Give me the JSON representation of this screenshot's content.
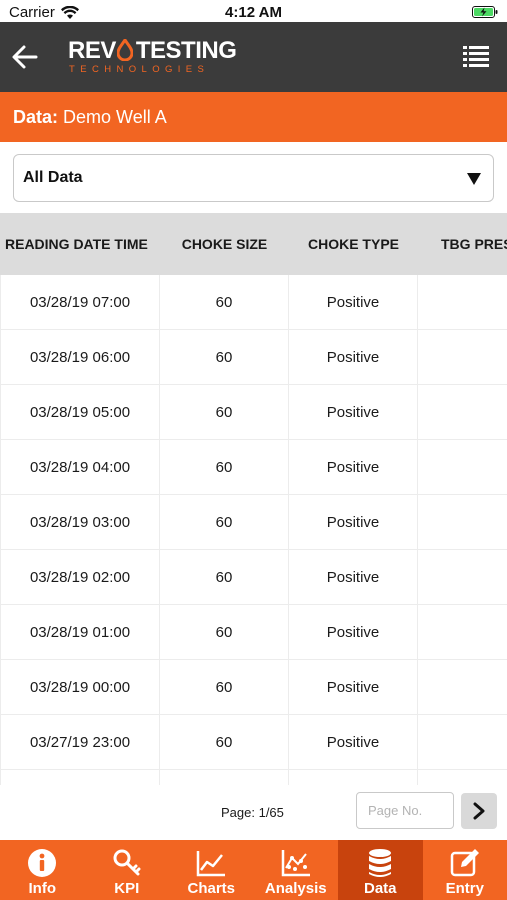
{
  "status_bar": {
    "carrier": "Carrier",
    "time": "4:12 AM"
  },
  "header": {
    "back_icon": "back-arrow-icon",
    "logo_brand_left": "REV",
    "logo_brand_right": "TESTING",
    "logo_sub": "TECHNOLOGIES",
    "menu_icon": "list-menu-icon"
  },
  "data_bar": {
    "label": "Data:",
    "well_name": "Demo Well A"
  },
  "filter": {
    "selected": "All Data",
    "caret_icon": "caret-down-icon"
  },
  "table": {
    "columns": [
      "READING DATE TIME",
      "CHOKE SIZE",
      "CHOKE TYPE",
      "TBG PRES"
    ],
    "rows": [
      [
        "03/28/19 07:00",
        "60",
        "Positive",
        ""
      ],
      [
        "03/28/19 06:00",
        "60",
        "Positive",
        ""
      ],
      [
        "03/28/19 05:00",
        "60",
        "Positive",
        ""
      ],
      [
        "03/28/19 04:00",
        "60",
        "Positive",
        ""
      ],
      [
        "03/28/19 03:00",
        "60",
        "Positive",
        ""
      ],
      [
        "03/28/19 02:00",
        "60",
        "Positive",
        ""
      ],
      [
        "03/28/19 01:00",
        "60",
        "Positive",
        ""
      ],
      [
        "03/28/19 00:00",
        "60",
        "Positive",
        ""
      ],
      [
        "03/27/19 23:00",
        "60",
        "Positive",
        ""
      ]
    ]
  },
  "pagination": {
    "page_text": "Page: 1/65",
    "input_placeholder": "Page No.",
    "next_icon": "chevron-right-icon"
  },
  "tabs": [
    {
      "label": "Info",
      "icon": "info-icon",
      "active": false
    },
    {
      "label": "KPI",
      "icon": "key-icon",
      "active": false
    },
    {
      "label": "Charts",
      "icon": "line-chart-icon",
      "active": false
    },
    {
      "label": "Analysis",
      "icon": "scatter-analysis-icon",
      "active": false
    },
    {
      "label": "Data",
      "icon": "database-icon",
      "active": true
    },
    {
      "label": "Entry",
      "icon": "edit-icon",
      "active": false
    }
  ],
  "colors": {
    "accent": "#f26522",
    "active_tab": "#c8430d",
    "header_bg": "#3b3b3b",
    "table_header_bg": "#dcdcdc"
  }
}
